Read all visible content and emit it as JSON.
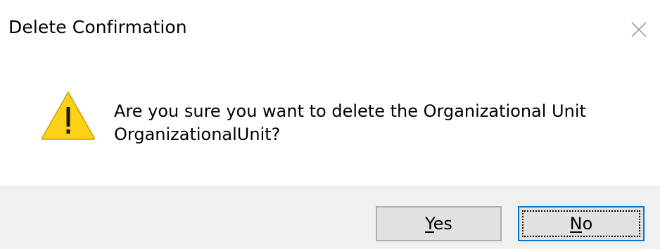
{
  "dialog": {
    "title": "Delete Confirmation",
    "close_icon": "close-icon",
    "warning_icon": "warning-triangle-icon",
    "message_line1": "Are you sure you want to delete the Organizational Unit",
    "message_line2": "OrganizationalUnit?",
    "buttons": {
      "yes_label": "Yes",
      "no_label": "No",
      "default": "No"
    }
  },
  "colors": {
    "footer_background": "#f0f0f0",
    "button_background": "#e1e1e1",
    "focus_border": "#0078d7",
    "warning_fill": "#fcd116"
  }
}
